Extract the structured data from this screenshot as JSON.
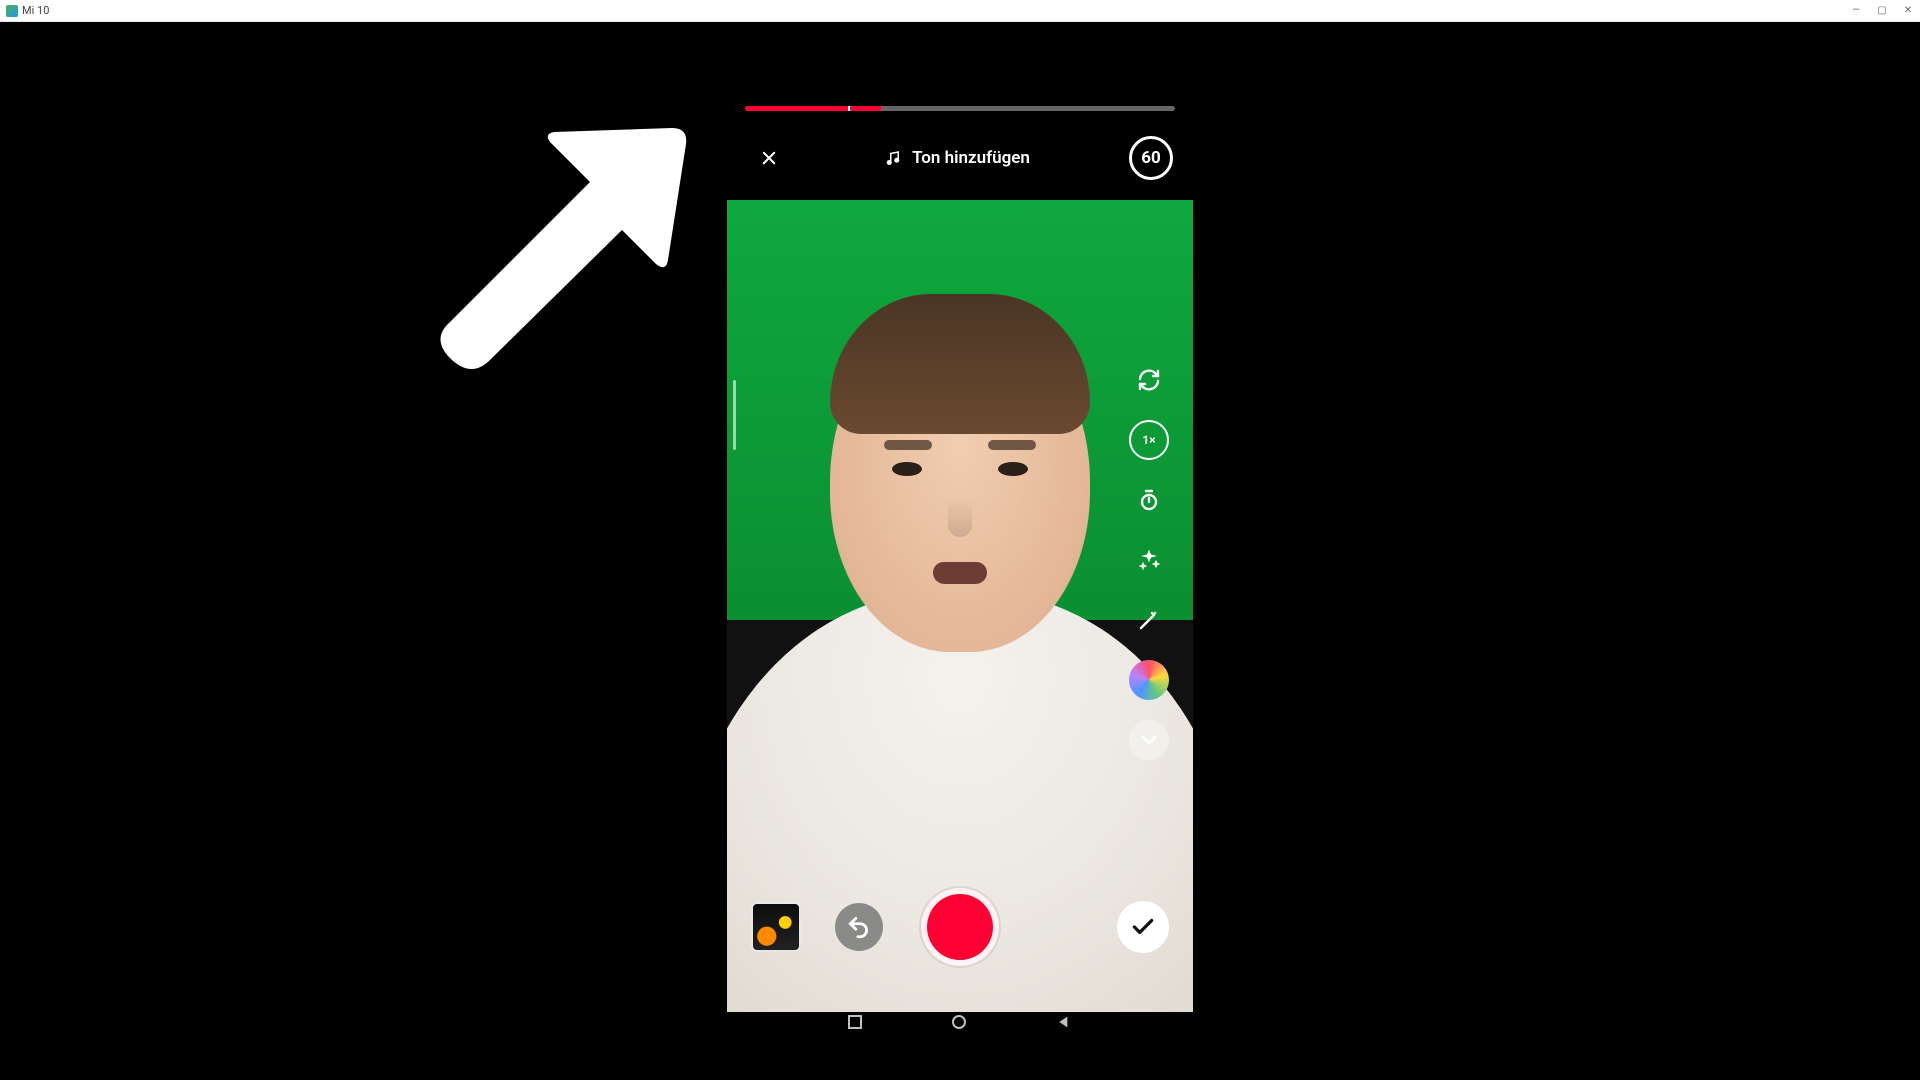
{
  "window": {
    "title": "Mi 10",
    "controls": {
      "min": "—",
      "max": "▢",
      "close": "✕"
    }
  },
  "progress": {
    "segment1_pct": 24,
    "segment2_start_pct": 24.7,
    "segment2_width_pct": 7
  },
  "top": {
    "add_sound_label": "Ton hinzufügen",
    "duration_label": "60"
  },
  "tools": {
    "flip": "flip-camera-icon",
    "speed_label": "1×",
    "timer": "timer-icon",
    "beauty": "sparkles-icon",
    "retouch": "magic-wand-icon",
    "filters": "color-filters-icon",
    "more": "chevron-down-icon"
  },
  "bottom": {
    "gallery": "gallery-thumbnail",
    "undo": "undo-icon",
    "record": "record-button",
    "confirm": "checkmark-icon"
  },
  "android_nav": {
    "recent": "recent-apps",
    "home": "home",
    "back": "back"
  }
}
